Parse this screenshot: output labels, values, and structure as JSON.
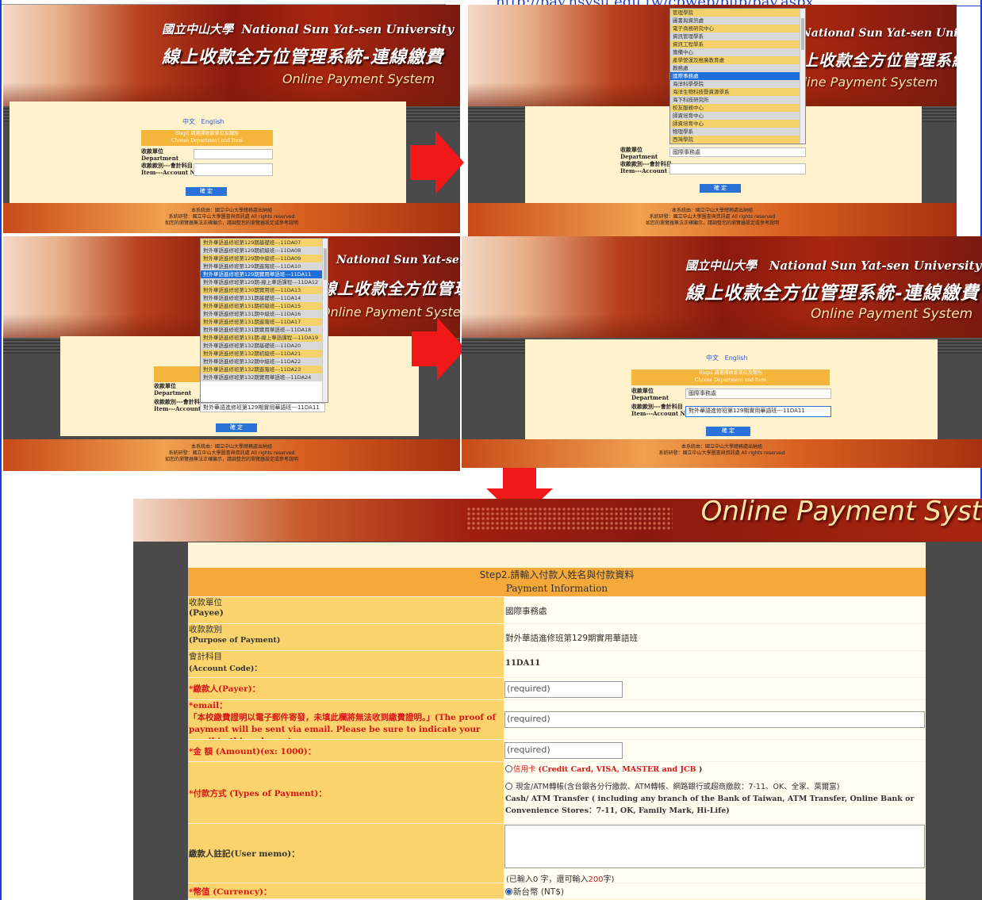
{
  "top": {
    "left_title": "ty",
    "link_text": "http://pay.nsysu.edu.tw/cpweb/pub/pay.aspx"
  },
  "branding": {
    "uni_zh": "國立中山大學",
    "uni_en": "National Sun Yat-sen University",
    "system_zh": "線上收款全方位管理系統-連線繳費",
    "system_en": "Online Payment System"
  },
  "step1": {
    "lang_zh": "中文",
    "lang_en": "English",
    "title_zh": "Step1.請選擇收款單位及類別",
    "title_en": "Choose Department and Item",
    "dept_zh": "收款單位",
    "dept_en": "Department",
    "acct_zh": "收款款別---會計科目",
    "acct_en": "Item---Account No",
    "confirm": "確 定",
    "footer1": "本系統由：國立中山大學總務處出納組",
    "footer2": "系統研發：國立中山大學圖書與資訊處 All rights reserved",
    "footer3": "如您的瀏覽器無法正確顯示，請調整您的瀏覽器設定或參考說明"
  },
  "shot2": {
    "dept_selected": "國際事務處",
    "dept_options": [
      "管理學院",
      "圖書與資訊處",
      "電子商務研究中心",
      "資訊管理學系",
      "資訊工程學系",
      "籌備中心",
      "產學營運及推廣教育處",
      "教務處",
      "國際事務處",
      "海洋科學學院",
      "海洋生物科技暨資源學系",
      "海下科技研究所",
      "校友服務中心",
      "師資培育中心",
      "師資培育中心",
      "物理學系",
      "西灣學院"
    ]
  },
  "shot3": {
    "acct_selected": "對外華語進修班第129期實用華語班---11DA11",
    "acct_options": [
      "對外華語進修班第129期基礎班---11DA07",
      "對外華語進修班第129期初級班---11DA08",
      "對外華語進修班第129期中級班---11DA09",
      "對外華語進修班第129期進階班---11DA10",
      "對外華語進修班第129期實用華語班---11DA11",
      "對外華語進修班第129期-線上華語課程---11DA12",
      "對外華語進修班第130期實用班---11DA13",
      "對外華語進修班第131期基礎班---11DA14",
      "對外華語進修班第131期初級班---11DA15",
      "對外華語進修班第131期中級班---11DA16",
      "對外華語進修班第131期進階班---11DA17",
      "對外華語進修班第131期實用華語班---11DA18",
      "對外華語進修班第131期-線上華語課程---11DA19",
      "對外華語進修班第132期基礎班---11DA20",
      "對外華語進修班第132期初級班---11DA21",
      "對外華語進修班第132期中級班---11DA22",
      "對外華語進修班第132期進階班---11DA23",
      "對外華語進修班第132期實用華語班---11DA24"
    ]
  },
  "form": {
    "engbanner": "Online Payment Syst",
    "header_zh": "Step2.請輸入付款人姓名與付款資料",
    "header_en": "Payment Information",
    "payee_zh": "收款單位",
    "payee_en": "(Payee)",
    "payee_value": "國際事務處",
    "purpose_zh": "收款款別",
    "purpose_en": "(Purpose of Payment)",
    "purpose_value": "對外華語進修班第129期實用華語班",
    "code_zh": "會計科目",
    "code_en": "(Account Code)：",
    "code_value": "11DA11",
    "payer_label": "*繳款人(Payer)：",
    "payer_placeholder": "(required)",
    "email_label": "*email：",
    "email_note": "「本校繳費證明以電子郵件寄發，未填此欄將無法收到繳費證明。」(The proof of payment will be sent via email. Please be sure to indicate your email in this column.)",
    "email_placeholder": "(required)",
    "amount_label": "*金 額 (Amount)(ex: 1000)：",
    "amount_placeholder": "(required)",
    "ptype_label": "*付款方式 (Types of Payment)：",
    "pay1_zh": "信用卡 ",
    "pay1_a": "(Credit Card, ",
    "pay1_b": "VISA, MASTER and JCB",
    "pay1_c": " )",
    "pay2_zh": " 現金/ATM轉帳(含台銀各分行繳款、ATM轉帳、網路銀行或超商繳款：7-11、OK、全家、萊爾富)",
    "pay2_en": "Cash/ ATM Transfer ( including any branch of the Bank of Taiwan, ATM Transfer, Online Bank or Convenience Stores：7-11, OK, Family Mark, Hi-Life)",
    "memo_label": "繳款人註記(User memo)：",
    "memo_count_a": "(已輸入0 字，還可輸入",
    "memo_count_b": "200",
    "memo_count_c": "字)",
    "currency_label": "*幣值 (Currency)：",
    "currency_value": "新台幣 (NT$)"
  }
}
